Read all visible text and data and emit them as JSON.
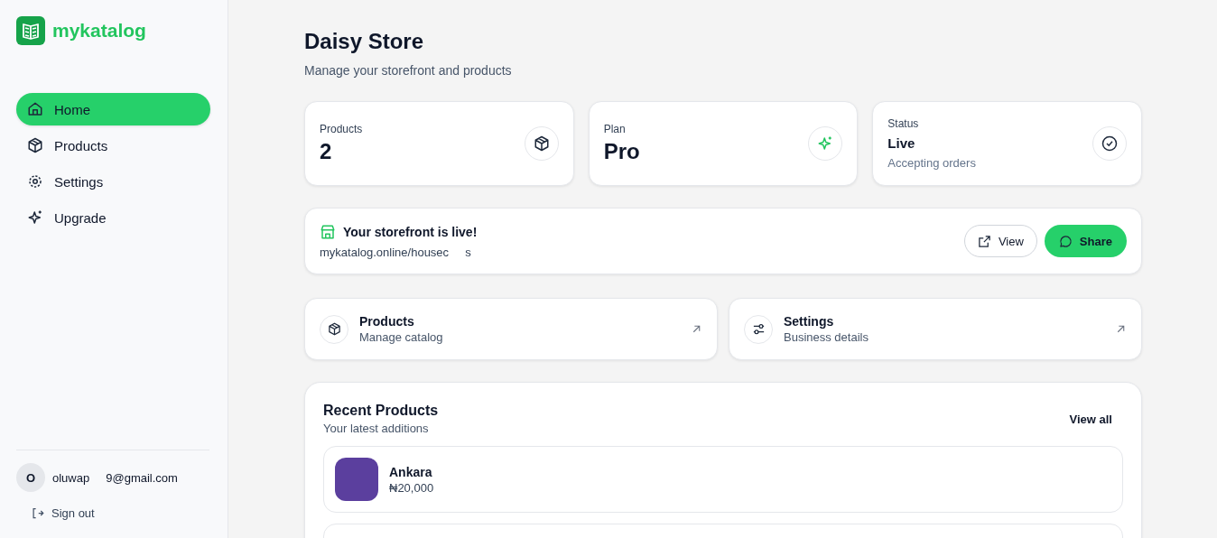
{
  "brand": {
    "name": "mykatalog"
  },
  "sidebar": {
    "items": [
      {
        "label": "Home",
        "selected": true
      },
      {
        "label": "Products",
        "selected": false
      },
      {
        "label": "Settings",
        "selected": false
      },
      {
        "label": "Upgrade",
        "selected": false
      }
    ],
    "user": {
      "initial": "O",
      "email": "oluwap     9@gmail.com"
    },
    "sign_out": "Sign out"
  },
  "header": {
    "title": "Daisy Store",
    "subtitle": "Manage your storefront and products"
  },
  "stats": [
    {
      "label": "Products",
      "value": "2",
      "kind": "big"
    },
    {
      "label": "Plan",
      "value": "Pro",
      "kind": "big"
    },
    {
      "label": "Status",
      "value": "Live",
      "kind": "status",
      "note": "Accepting orders"
    }
  ],
  "storefront": {
    "title": "Your storefront is live!",
    "url": "mykatalog.online/housec     s",
    "view": "View",
    "share": "Share"
  },
  "shortcuts": [
    {
      "title": "Products",
      "subtitle": "Manage catalog"
    },
    {
      "title": "Settings",
      "subtitle": "Business details"
    }
  ],
  "recent": {
    "title": "Recent Products",
    "subtitle": "Your latest additions",
    "view_all": "View all",
    "items": [
      {
        "name": "Ankara",
        "price": "₦20,000"
      }
    ]
  }
}
